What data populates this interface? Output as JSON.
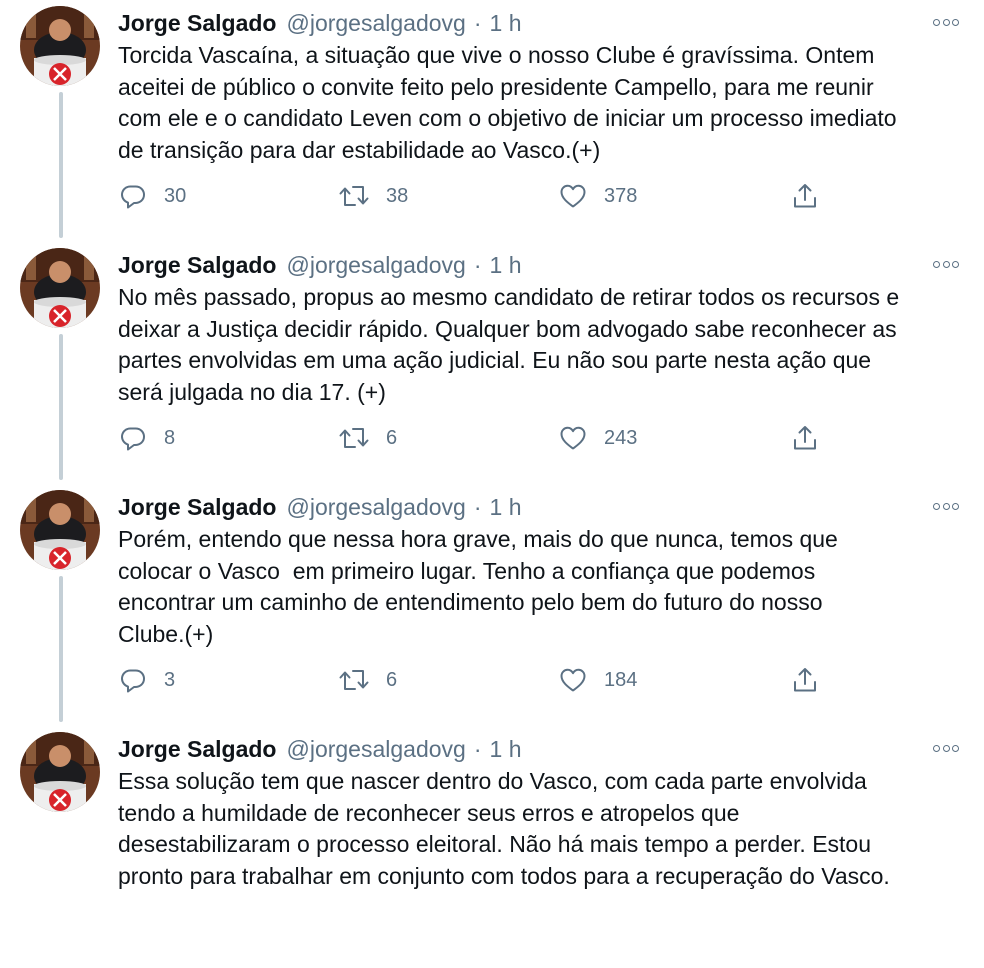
{
  "tweets": [
    {
      "name": "Jorge Salgado",
      "handle": "@jorgesalgadovg",
      "separator": "·",
      "time": "1 h",
      "lines": [
        "Torcida Vascaína, a situação que vive o nosso Clube é gravíssima. Ontem",
        "aceitei de público o convite feito pelo presidente Campello, para me reunir",
        "com ele e o candidato Leven com o objetivo de iniciar um processo imediato",
        "de transição para dar estabilidade ao Vasco.(+)"
      ],
      "replies": "30",
      "retweets": "38",
      "likes": "378"
    },
    {
      "name": "Jorge Salgado",
      "handle": "@jorgesalgadovg",
      "separator": "·",
      "time": "1 h",
      "lines": [
        "No mês passado, propus ao mesmo candidato de retirar todos os recursos e",
        "deixar a Justiça decidir rápido. Qualquer bom advogado sabe reconhecer as",
        "partes envolvidas em uma ação judicial. Eu não sou parte nesta ação que",
        "será julgada no dia 17. (+)"
      ],
      "replies": "8",
      "retweets": "6",
      "likes": "243"
    },
    {
      "name": "Jorge Salgado",
      "handle": "@jorgesalgadovg",
      "separator": "·",
      "time": "1 h",
      "lines": [
        "Porém, entendo que nessa hora grave, mais do que nunca, temos que",
        "colocar o Vasco  em primeiro lugar. Tenho a confiança que podemos",
        "encontrar um caminho de entendimento pelo bem do futuro do nosso",
        "Clube.(+)"
      ],
      "replies": "3",
      "retweets": "6",
      "likes": "184"
    },
    {
      "name": "Jorge Salgado",
      "handle": "@jorgesalgadovg",
      "separator": "·",
      "time": "1 h",
      "lines": [
        "Essa solução tem que nascer dentro do Vasco, com cada parte envolvida",
        "tendo a humildade de reconhecer seus erros e atropelos que",
        "desestabilizaram o processo eleitoral. Não há mais tempo a perder. Estou",
        "pronto para trabalhar em conjunto com todos para a recuperação do Vasco."
      ]
    }
  ],
  "icons": {
    "reply": "reply-icon",
    "retweet": "retweet-icon",
    "like": "heart-icon",
    "share": "share-icon",
    "more": "more-options-icon"
  },
  "colors": {
    "text": "#0f1419",
    "secondary": "#5b7083",
    "thread_line": "#c4cfd6",
    "avatar_badge_red": "#d8242b"
  }
}
